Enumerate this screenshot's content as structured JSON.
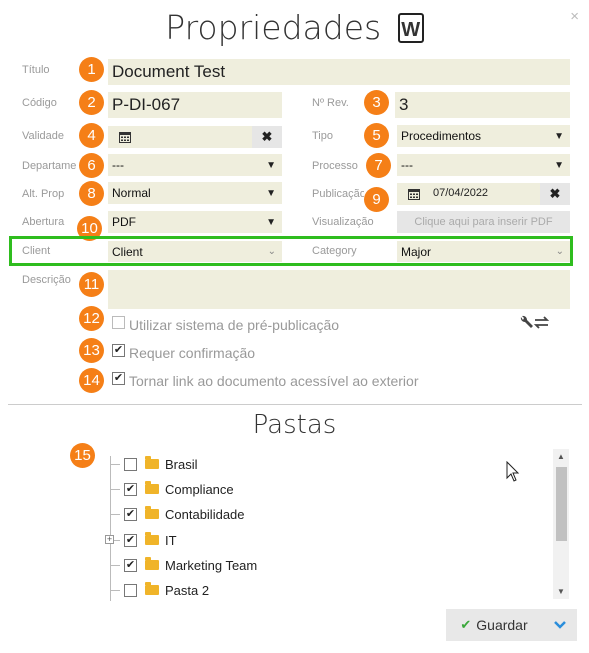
{
  "dialog": {
    "title": "Propriedades",
    "word_icon_letter": "W",
    "close_glyph": "×"
  },
  "fields": {
    "titulo_label": "Título",
    "titulo_value": "Document Test",
    "codigo_label": "Código",
    "codigo_value": "P-DI-067",
    "rev_label": "Nº Rev.",
    "rev_value": "3",
    "validade_label": "Validade",
    "validade_value": "",
    "tipo_label": "Tipo",
    "tipo_value": "Procedimentos",
    "departamento_label": "Departame",
    "departamento_value": "---",
    "processo_label": "Processo",
    "processo_value": "---",
    "altprop_label": "Alt. Prop",
    "altprop_value": "Normal",
    "publicacao_label": "Publicação",
    "publicacao_value": "07/04/2022",
    "abertura_label": "Abertura",
    "abertura_value": "PDF",
    "visualizacao_label": "Visualização",
    "visualizacao_button": "Clique aqui para inserir PDF",
    "client_label": "Client",
    "client_value": "Client",
    "category_label": "Category",
    "category_value": "Major",
    "descricao_label": "Descrição",
    "descricao_value": ""
  },
  "options": {
    "pre_pub_label": "Utilizar sistema de pré-publicação",
    "pre_pub_checked": false,
    "requer_label": "Requer confirmação",
    "requer_checked": true,
    "link_label": "Tornar link ao documento acessível ao exterior",
    "link_checked": true
  },
  "badges": [
    "1",
    "2",
    "3",
    "4",
    "5",
    "6",
    "7",
    "8",
    "9",
    "10",
    "11",
    "12",
    "13",
    "14",
    "15"
  ],
  "folders": {
    "title": "Pastas",
    "items": [
      {
        "name": "Brasil",
        "checked": false,
        "expandable": false
      },
      {
        "name": "Compliance",
        "checked": true,
        "expandable": false
      },
      {
        "name": "Contabilidade",
        "checked": true,
        "expandable": false
      },
      {
        "name": "IT",
        "checked": true,
        "expandable": true
      },
      {
        "name": "Marketing Team",
        "checked": true,
        "expandable": false
      },
      {
        "name": "Pasta 2",
        "checked": false,
        "expandable": false
      }
    ]
  },
  "footer": {
    "save_label": "Guardar"
  },
  "colors": {
    "badge": "#f57f17",
    "field_bg": "#efeedd",
    "highlight_border": "#2fbd1e",
    "save_check": "#3aa83a",
    "dropdown_chevron": "#2a8ddb"
  },
  "icons": {
    "calendar": "calendar-icon",
    "clear": "clear-x-icon",
    "tools": "wrench-arrows-icon",
    "cursor": "mouse-pointer-icon"
  }
}
